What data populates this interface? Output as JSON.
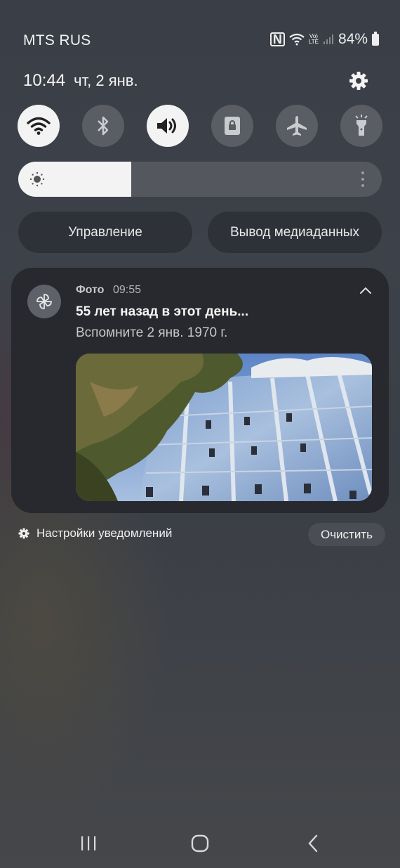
{
  "status_bar": {
    "carrier": "MTS RUS",
    "nfc_label": "N",
    "volte_top": "Vo)",
    "volte_bottom": "LTE",
    "battery": "84%",
    "icons": [
      "nfc-icon",
      "wifi-icon",
      "volte-icon",
      "signal-icon",
      "battery-icon"
    ]
  },
  "header": {
    "time": "10:44",
    "date": "чт, 2 янв.",
    "settings_icon": "gear-icon"
  },
  "quick_toggles": [
    {
      "name": "wifi",
      "icon": "wifi-icon",
      "state": "on"
    },
    {
      "name": "bluetooth",
      "icon": "bluetooth-icon",
      "state": "off"
    },
    {
      "name": "sound",
      "icon": "speaker-icon",
      "state": "on"
    },
    {
      "name": "rotation-lock",
      "icon": "lock-icon",
      "state": "off"
    },
    {
      "name": "airplane-mode",
      "icon": "airplane-icon",
      "state": "off"
    },
    {
      "name": "flashlight",
      "icon": "flashlight-icon",
      "state": "off"
    }
  ],
  "brightness": {
    "level": 0.31,
    "icon": "sun-icon"
  },
  "buttons": {
    "device_control": "Управление",
    "media_output": "Вывод медиаданных"
  },
  "notification": {
    "app_name": "Фото",
    "time": "09:55",
    "title": "55 лет назад в этот день...",
    "subtitle": "Вспомните 2 янв. 1970 г.",
    "icon": "pinwheel-icon"
  },
  "footer": {
    "notification_settings": "Настройки уведомлений",
    "clear": "Очистить"
  },
  "nav_bar": [
    "recents-icon",
    "home-icon",
    "back-icon"
  ],
  "colors": {
    "toggle_on": "#f3f3f3",
    "toggle_off": "#5a5d63",
    "card": "#27292e"
  }
}
